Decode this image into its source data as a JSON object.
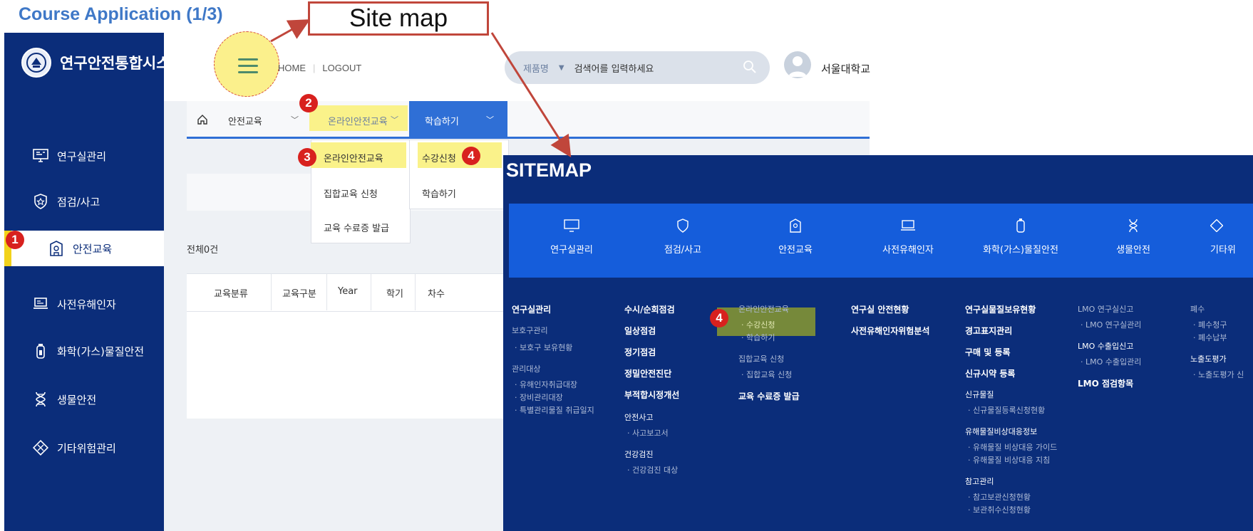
{
  "slide_title": "Course Application (1/3)",
  "callout": "Site map",
  "app": {
    "name": "연구안전통합시스템"
  },
  "header": {
    "home": "HOME",
    "logout": "LOGOUT",
    "search_category": "제품명",
    "search_placeholder": "검색어를 입력하세요",
    "user": "서울대학교"
  },
  "sidebar": {
    "items": [
      {
        "label": "연구실관리",
        "icon": "monitor-icon"
      },
      {
        "label": "점검/사고",
        "icon": "shield-icon"
      },
      {
        "label": "안전교육",
        "icon": "education-icon",
        "active": true
      },
      {
        "label": "사전유해인자",
        "icon": "laptop-icon"
      },
      {
        "label": "화학(가스)물질안전",
        "icon": "gas-cylinder-icon"
      },
      {
        "label": "생물안전",
        "icon": "dna-icon"
      },
      {
        "label": "기타위험관리",
        "icon": "hazard-icon"
      }
    ]
  },
  "breadcrumb": {
    "level1": "안전교육",
    "level2": "온라인안전교육",
    "level3": "학습하기"
  },
  "dropdown1": [
    "온라인안전교육",
    "집합교육 신청",
    "교육 수료증 발급"
  ],
  "dropdown2": [
    "수강신청",
    "학습하기"
  ],
  "list": {
    "total": "전체0건",
    "columns": [
      "교육분류",
      "교육구분",
      "Year",
      "학기",
      "차수"
    ]
  },
  "badges": {
    "b1": "1",
    "b2": "2",
    "b3": "3",
    "b4": "4"
  },
  "sitemap": {
    "title": "SITEMAP",
    "categories": [
      "연구실관리",
      "점검/사고",
      "안전교육",
      "사전유해인자",
      "화학(가스)물질안전",
      "생물안전",
      "기타위"
    ],
    "col1": {
      "heading": "연구실관리",
      "items": [
        "보호구관리",
        "· 보호구 보유현황",
        "관리대상",
        "· 유해인자취급대장",
        "· 장비관리대장",
        "· 특별관리물질 취급일지"
      ]
    },
    "col2": {
      "items": [
        "수시/순회점검",
        "일상점검",
        "정기점검",
        "정밀안전진단",
        "부적합시정개선",
        "안전사고",
        "· 사고보고서",
        "건강검진",
        "· 건강검진 대상"
      ]
    },
    "col3": {
      "items": [
        "온라인안전교육",
        "· 수강신청",
        "· 학습하기",
        "집합교육 신청",
        "· 집합교육 신청",
        "교육 수료증 발급"
      ]
    },
    "col4": {
      "items": [
        "연구실 안전현황",
        "사전유해인자위험분석"
      ]
    },
    "col5": {
      "items": [
        "연구실물질보유현황",
        "경고표지관리",
        "구매 및 등록",
        "신규시약 등록",
        "신규물질",
        "· 신규물질등록신청현황",
        "유해물질비상대응정보",
        "· 유해물질 비상대응 가이드",
        "· 유해물질 비상대응 지침",
        "참고관리",
        "· 참고보관신청현황",
        "· 보관취수신청현황"
      ]
    },
    "col6": {
      "items": [
        "LMO 연구실신고",
        "· LMO 연구실관리",
        "LMO 수출입신고",
        "· LMO 수출입관리",
        "LMO 점검항목"
      ]
    },
    "col7": {
      "items": [
        "폐수",
        "· 폐수청구",
        "· 폐수납부",
        "노출도평가",
        "· 노출도평가 신"
      ]
    }
  }
}
